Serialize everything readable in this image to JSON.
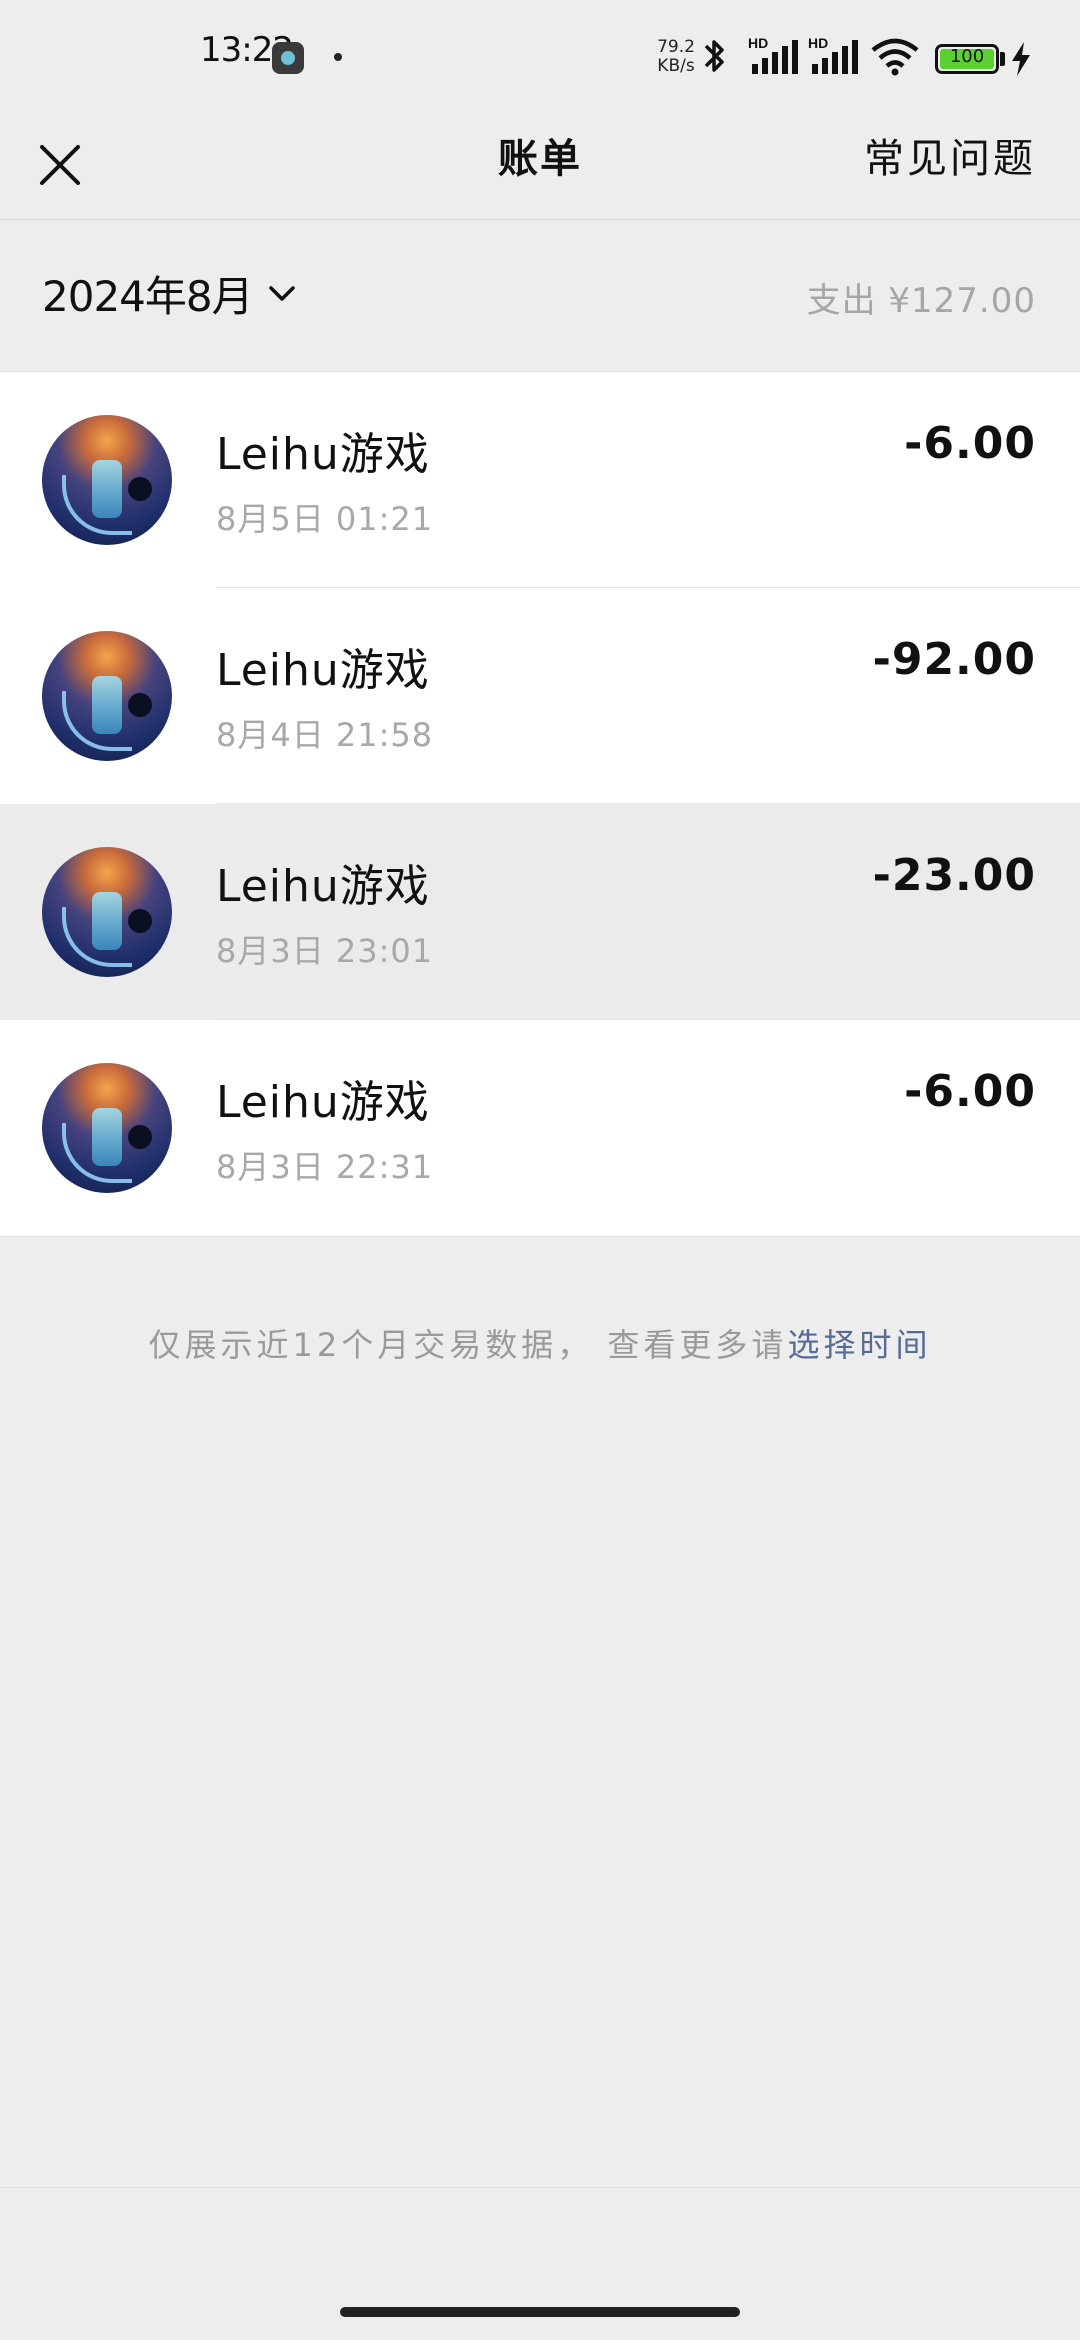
{
  "status_bar": {
    "time": "13:22",
    "net_speed_value": "79.2",
    "net_speed_unit": "KB/s",
    "battery": "100",
    "icons": [
      "app-notification-icon",
      "bluetooth-icon",
      "signal-hd-icon",
      "signal-hd-icon",
      "wifi-icon",
      "battery-icon",
      "charging-icon"
    ]
  },
  "navbar": {
    "title": "账单",
    "faq_label": "常见问题"
  },
  "month_bar": {
    "month_label": "2024年8月",
    "spend_label": "支出 ¥127.00"
  },
  "transactions": [
    {
      "name": "Leihu游戏",
      "time": "8月5日 01:21",
      "amount": "-6.00"
    },
    {
      "name": "Leihu游戏",
      "time": "8月4日 21:58",
      "amount": "-92.00"
    },
    {
      "name": "Leihu游戏",
      "time": "8月3日 23:01",
      "amount": "-23.00"
    },
    {
      "name": "Leihu游戏",
      "time": "8月3日 22:31",
      "amount": "-6.00"
    }
  ],
  "footer_note": {
    "text": "仅展示近12个月交易数据， 查看更多请",
    "link_label": "选择时间"
  },
  "colors": {
    "background": "#ededed",
    "link": "#576b95",
    "muted_text": "#a8a8a8",
    "battery_fill": "#5ad12f"
  }
}
